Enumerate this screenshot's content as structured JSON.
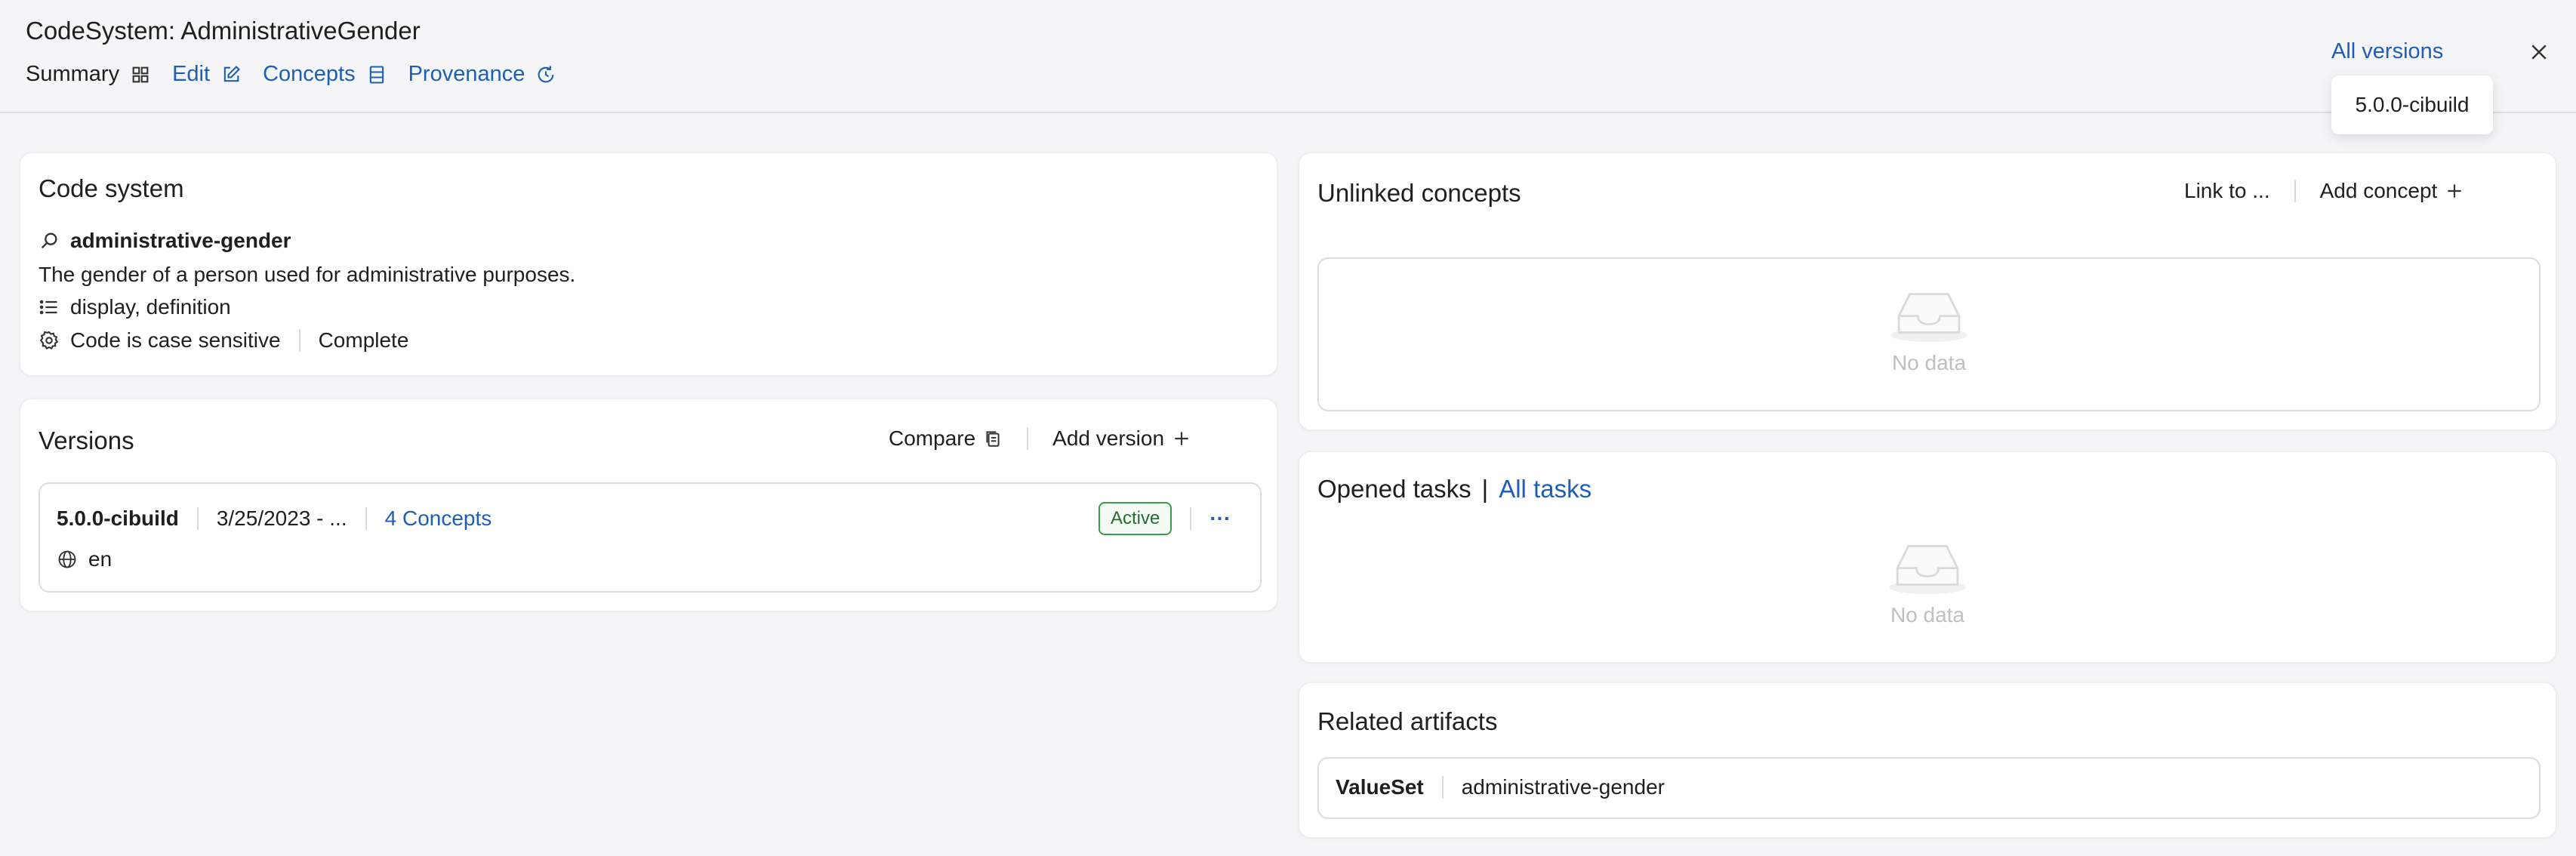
{
  "header": {
    "title": "CodeSystem: AdministrativeGender",
    "nav": {
      "summary": "Summary",
      "edit": "Edit",
      "concepts": "Concepts",
      "provenance": "Provenance"
    },
    "all_versions": "All versions",
    "version_popup": "5.0.0-cibuild"
  },
  "code_system": {
    "title": "Code system",
    "id": "administrative-gender",
    "description": "The gender of a person used for administrative purposes.",
    "properties": "display, definition",
    "case_sensitive": "Code is case sensitive",
    "content": "Complete"
  },
  "versions": {
    "title": "Versions",
    "compare": "Compare",
    "add_version": "Add version",
    "item": {
      "version": "5.0.0-cibuild",
      "date": "3/25/2023 - ...",
      "concepts": "4 Concepts",
      "status": "Active",
      "more": "···",
      "language": "en"
    }
  },
  "unlinked": {
    "title": "Unlinked concepts",
    "link_to": "Link to ...",
    "add_concept": "Add concept",
    "empty": "No data"
  },
  "tasks": {
    "title": "Opened tasks",
    "separator": "|",
    "all_tasks": "All tasks",
    "empty": "No data"
  },
  "artifacts": {
    "title": "Related artifacts",
    "type": "ValueSet",
    "name": "administrative-gender"
  },
  "colors": {
    "link": "#1d5fb5",
    "active": "#3a9b4a"
  }
}
